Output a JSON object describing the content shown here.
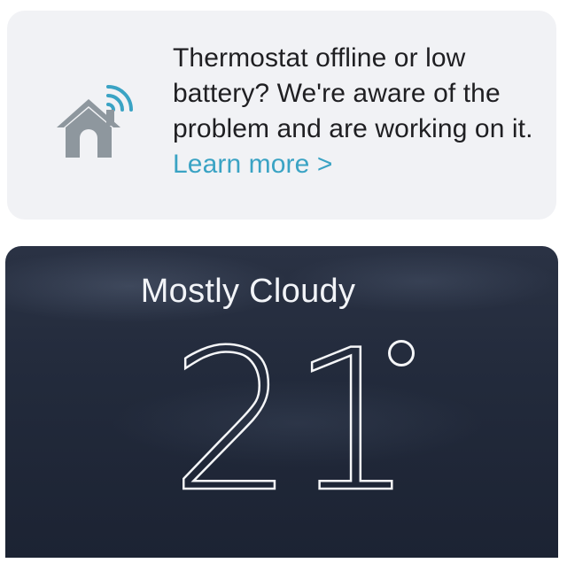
{
  "alert": {
    "message": "Thermostat offline or low battery? We're aware of the problem and are working on it. ",
    "link_label": "Learn more >",
    "icon": "house-wifi-icon",
    "link_color": "#3aa3c4",
    "background": "#f1f2f5"
  },
  "weather": {
    "condition": "Mostly Cloudy",
    "temperature": "21",
    "degree_symbol": "°",
    "background": "#222a3b"
  }
}
